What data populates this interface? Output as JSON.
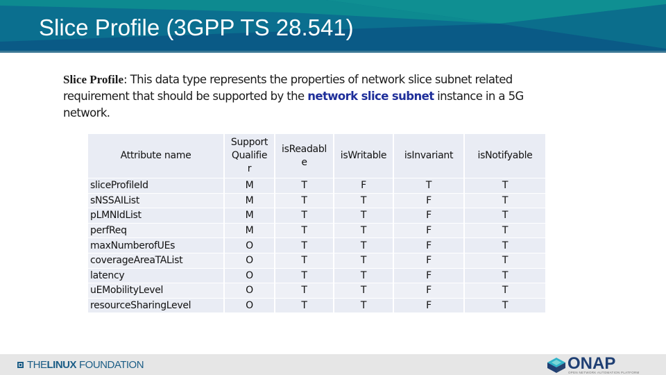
{
  "header": {
    "title": "Slice Profile (3GPP TS 28.541)"
  },
  "intro": {
    "term": "Slice Profile",
    "text_before": ": This  data type represents the properties of network slice subnet related requirement that should be supported by the ",
    "highlight": "network slice subnet",
    "text_after": " instance in a 5G network."
  },
  "table": {
    "headers": [
      "Attribute name",
      "Support Qualifie r",
      "isReadabl e",
      "isWritable",
      "isInvariant",
      "isNotifyable"
    ],
    "rows": [
      [
        "sliceProfileId",
        "M",
        "T",
        "F",
        "T",
        "T"
      ],
      [
        "sNSSAIList",
        "M",
        "T",
        "T",
        "F",
        "T"
      ],
      [
        "pLMNIdList",
        "M",
        "T",
        "T",
        "F",
        "T"
      ],
      [
        "perfReq",
        "M",
        "T",
        "T",
        "F",
        "T"
      ],
      [
        "maxNumberofUEs",
        "O",
        "T",
        "T",
        "F",
        "T"
      ],
      [
        "coverageAreaTAList",
        "O",
        "T",
        "T",
        "F",
        "T"
      ],
      [
        "latency",
        "O",
        "T",
        "T",
        "F",
        "T"
      ],
      [
        "uEMobilityLevel",
        "O",
        "T",
        "T",
        "F",
        "T"
      ],
      [
        "resourceSharingLevel",
        "O",
        "T",
        "T",
        "F",
        "T"
      ]
    ]
  },
  "footer": {
    "left_logo": {
      "the": "THE",
      "linux": "LINUX",
      "foundation": "FOUNDATION"
    },
    "right_logo": {
      "word": "ONAP",
      "tagline": "OPEN NETWORK AUTOMATION PLATFORM"
    }
  },
  "colors": {
    "banner": "#0a6a8e",
    "highlight": "#1f2f9a",
    "table_cell": "#e9ecf4",
    "footer": "#e6e6e6"
  }
}
